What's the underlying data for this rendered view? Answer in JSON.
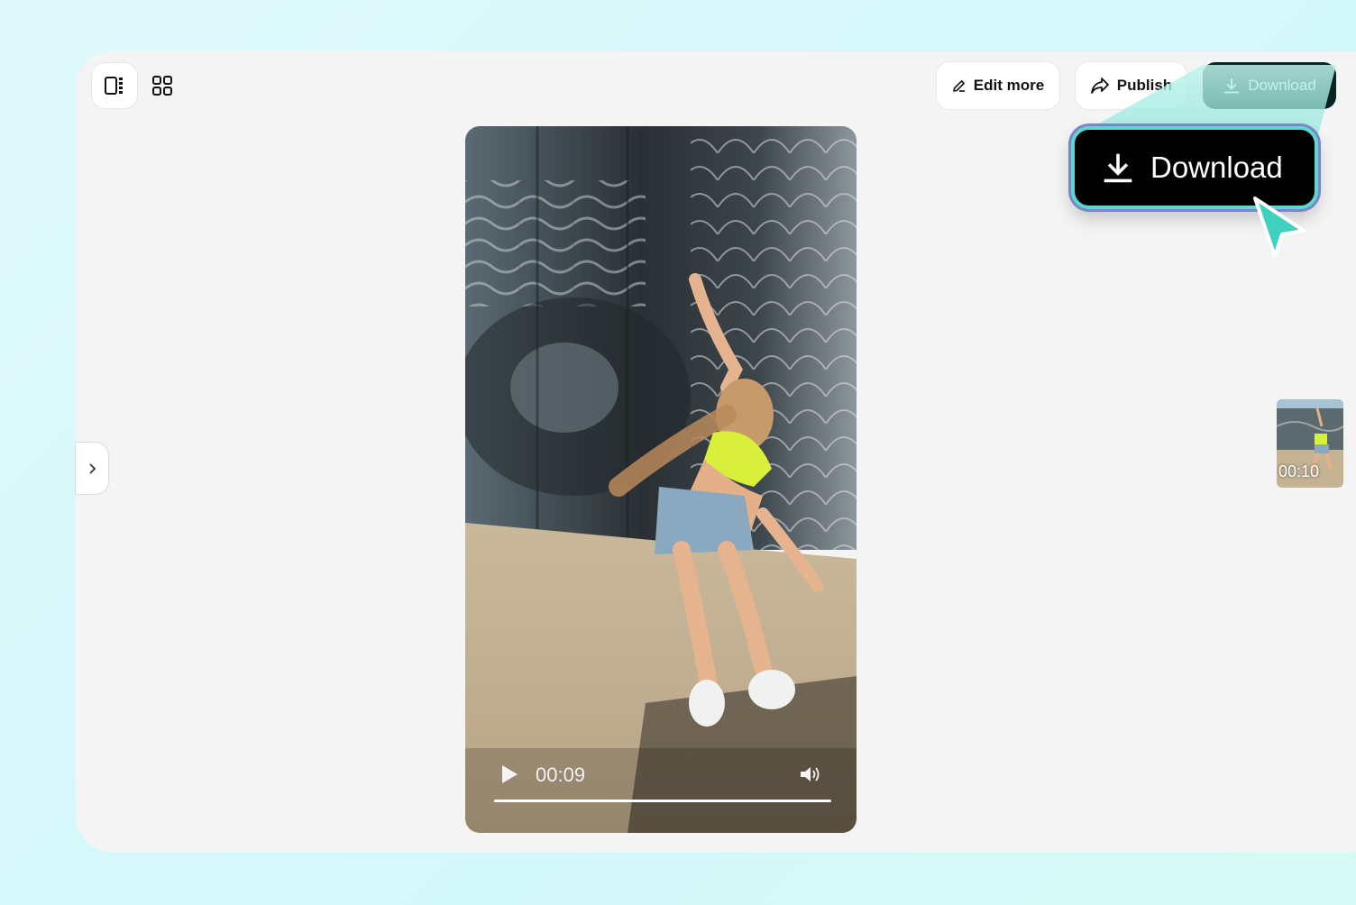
{
  "toolbar": {
    "layout_view_icon": "single-view-panel-icon",
    "grid_view_icon": "grid-view-icon",
    "edit_more_label": "Edit more",
    "edit_icon": "pencil-icon",
    "publish_label": "Publish",
    "publish_icon": "share-arrow-icon",
    "download_label": "Download",
    "download_icon": "download-icon"
  },
  "callout": {
    "label": "Download",
    "icon": "download-icon",
    "border_color": "#5bd8cf"
  },
  "sidebar": {
    "expand_icon": "chevron-right-icon"
  },
  "player": {
    "current_time": "00:09",
    "progress": 1.0,
    "play_icon": "play-icon",
    "volume_icon": "volume-icon"
  },
  "thumbnail": {
    "duration": "00:10"
  },
  "colors": {
    "download_button_bg": "#072523",
    "accent_teal": "#5bd8cf",
    "cursor_teal": "#3fd1c0"
  }
}
